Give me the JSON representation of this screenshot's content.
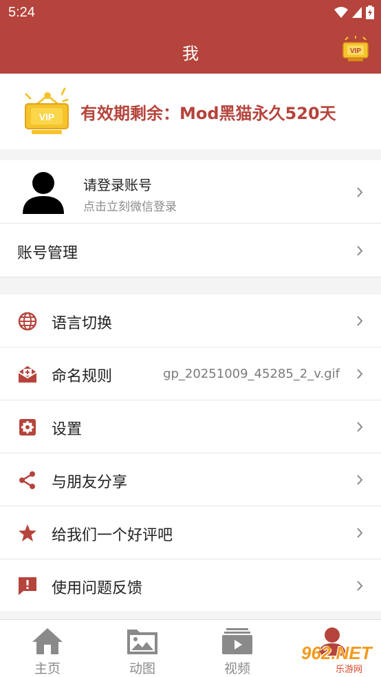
{
  "status_bar": {
    "time": "5:24"
  },
  "app_bar": {
    "title": "我",
    "vip_badge": "VIP"
  },
  "vip_banner": {
    "badge": "VIP",
    "text": "有效期剩余：Mod黑猫永久520天"
  },
  "login": {
    "title": "请登录账号",
    "subtitle": "点击立刻微信登录"
  },
  "account_row": {
    "label": "账号管理"
  },
  "menu": [
    {
      "label": "语言切换",
      "icon": "globe-icon",
      "value": ""
    },
    {
      "label": "命名规则",
      "icon": "mail-open-icon",
      "value": "gp_20251009_45285_2_v.gif"
    },
    {
      "label": "设置",
      "icon": "gear-icon",
      "value": ""
    },
    {
      "label": "与朋友分享",
      "icon": "share-icon",
      "value": ""
    },
    {
      "label": "给我们一个好评吧",
      "icon": "star-icon",
      "value": ""
    },
    {
      "label": "使用问题反馈",
      "icon": "feedback-icon",
      "value": ""
    }
  ],
  "tabs": [
    {
      "label": "主页",
      "icon": "home-icon",
      "active": false
    },
    {
      "label": "动图",
      "icon": "image-folder-icon",
      "active": false
    },
    {
      "label": "视频",
      "icon": "video-icon",
      "active": false
    },
    {
      "label": "",
      "icon": "profile-icon",
      "active": true
    }
  ],
  "watermark": {
    "text": "962.NET",
    "sub": "乐游网"
  },
  "colors": {
    "accent": "#b5443c",
    "vip_gold": "#f5c32c",
    "icon_red": "#b5443c",
    "tab_gray": "#8a8a8a"
  }
}
